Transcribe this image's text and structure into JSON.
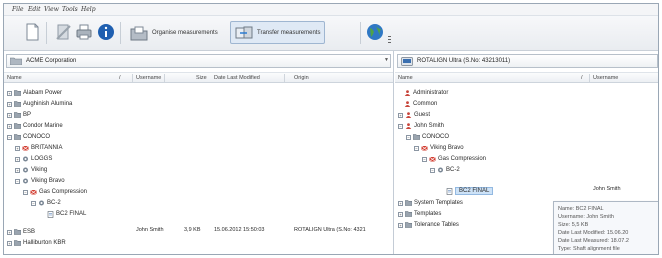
{
  "menu": [
    "File",
    "Edit",
    "View",
    "Tools",
    "Help"
  ],
  "toolbar": {
    "organise_label": "Organise measurements",
    "transfer_label": "Transfer measurements"
  },
  "left": {
    "path": "ACME Corporation",
    "columns": {
      "name": "Name",
      "username": "Username",
      "size": "Size",
      "date": "Date Last Modified",
      "origin": "Origin"
    },
    "tree": [
      {
        "label": "Alabam Power",
        "expander": "+"
      },
      {
        "label": "Aughinish Alumina",
        "expander": "+"
      },
      {
        "label": "BP",
        "expander": "+"
      },
      {
        "label": "Condor Marine",
        "expander": "+"
      },
      {
        "label": "CONOCO",
        "expander": "−"
      },
      {
        "label": "BRITANNIA",
        "expander": "+"
      },
      {
        "label": "LOGGS",
        "expander": "+"
      },
      {
        "label": "Viking",
        "expander": "+"
      },
      {
        "label": "Viking Bravo",
        "expander": "−"
      },
      {
        "label": "Gas Compression",
        "expander": "−"
      },
      {
        "label": "BC-2",
        "expander": "−"
      },
      {
        "label": "BC2 FINAL",
        "expander": ""
      },
      {
        "label": "ESB",
        "expander": "+"
      },
      {
        "label": "Halliburton KBR",
        "expander": "+"
      }
    ],
    "file_row": {
      "username": "John Smith",
      "size": "3,9 KB",
      "date": "15.06.2012 15:50:03",
      "origin": "ROTALIGN Ultra (S.No: 4321"
    }
  },
  "right": {
    "path": "ROTALIGN Ultra (S.No: 43213011)",
    "columns": {
      "name": "Name",
      "username": "Username"
    },
    "tree": [
      {
        "label": "Administrator",
        "expander": ""
      },
      {
        "label": "Common",
        "expander": ""
      },
      {
        "label": "Guest",
        "expander": "+"
      },
      {
        "label": "John Smith",
        "expander": "−"
      },
      {
        "label": "CONOCO",
        "expander": "−"
      },
      {
        "label": "Viking Bravo",
        "expander": "−"
      },
      {
        "label": "Gas Compression",
        "expander": "−"
      },
      {
        "label": "BC-2",
        "expander": "−"
      },
      {
        "label": "BC2 FINAL",
        "expander": ""
      },
      {
        "label": "System Templates",
        "expander": "+"
      },
      {
        "label": "Templates",
        "expander": "+"
      },
      {
        "label": "Tolerance Tables",
        "expander": "+"
      }
    ],
    "selected_username": "John Smith",
    "tooltip": [
      "Name: BC2 FINAL",
      "Username: John Smith",
      "Size: 5,5 KB",
      "Date Last Modified: 15.06.20",
      "Date Last Measured: 18.07.2",
      "Type: Shaft alignment file"
    ]
  }
}
